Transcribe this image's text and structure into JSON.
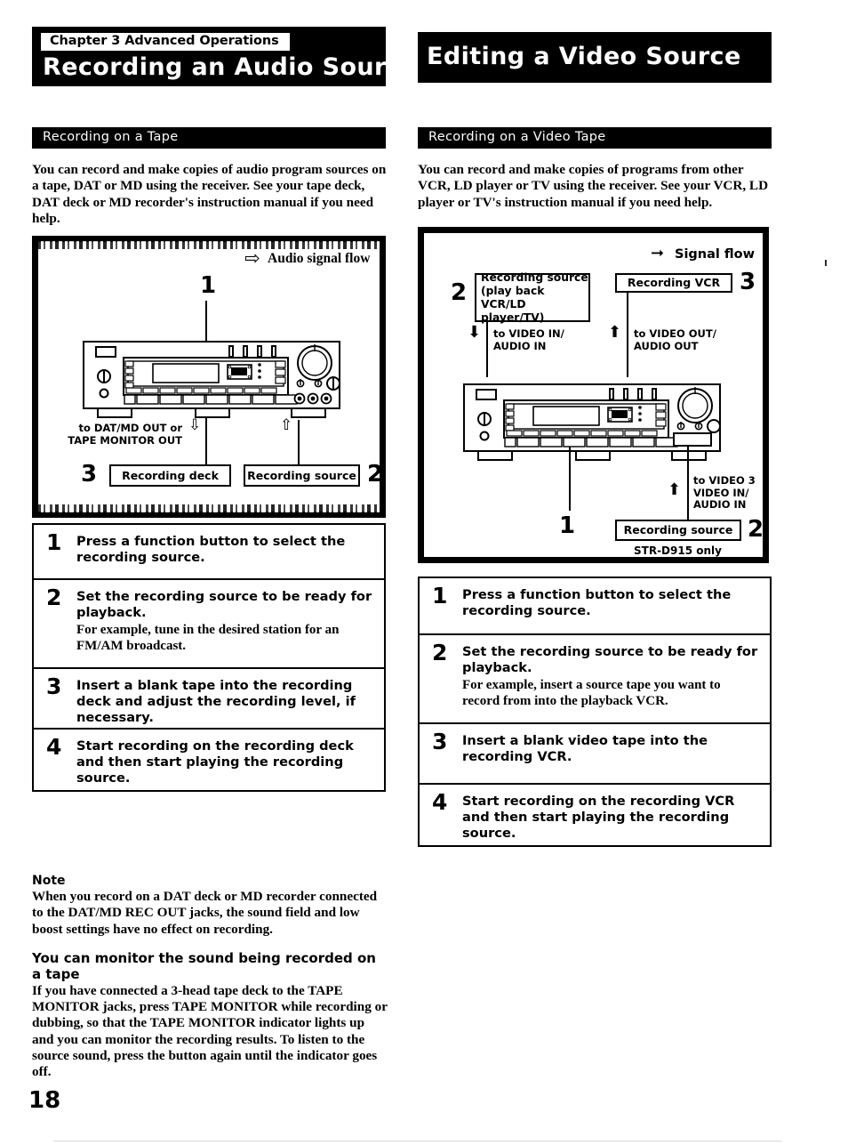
{
  "page": {
    "number": "18"
  },
  "left": {
    "chapter_tag": "Chapter 3 Advanced Operations",
    "title": "Recording an Audio Source",
    "section_bar": "Recording on a Tape",
    "intro": "You can record and make copies of audio program sources on a tape, DAT or MD using the receiver.  See your tape deck, DAT deck or MD recorder's instruction manual if you need help.",
    "diagram": {
      "flow_legend": "Audio signal flow",
      "flow_arrow_icon": "thick-right-arrow-icon",
      "callout_1": "1",
      "callout_2": "2",
      "callout_3": "3",
      "out_label": "to DAT/MD OUT or\nTAPE MONITOR OUT",
      "box_recording_deck": "Recording deck",
      "box_recording_source": "Recording source",
      "arrow_down_icon": "outline-down-arrow-icon",
      "arrow_up_icon": "outline-up-arrow-icon"
    },
    "steps": [
      {
        "num": "1",
        "head": "Press a function button to select the recording source.",
        "sub": ""
      },
      {
        "num": "2",
        "head": "Set the recording source to be ready for playback.",
        "sub": "For example, tune in the desired station for an FM/AM broadcast."
      },
      {
        "num": "3",
        "head": "Insert a blank tape into the recording deck and adjust the recording level, if necessary.",
        "sub": ""
      },
      {
        "num": "4",
        "head": "Start recording on the recording deck and then start playing the recording source.",
        "sub": ""
      }
    ],
    "notes": [
      {
        "head": "Note",
        "body": "When you record on a DAT deck or MD recorder connected to the DAT/MD REC OUT jacks, the sound field and low boost settings have no effect on recording."
      },
      {
        "head": "You can monitor the sound being recorded on a tape",
        "body": "If you have connected a 3-head tape deck to the TAPE MONITOR jacks, press TAPE MONITOR while recording or dubbing, so that the TAPE MONITOR indicator lights up and you can monitor the recording results. To listen to the source sound, press the button again until the indicator goes off."
      }
    ]
  },
  "right": {
    "title": "Editing a Video Source",
    "section_bar": "Recording on a Video Tape",
    "intro": "You can record and make copies of programs from other VCR, LD player or TV using the receiver.  See your VCR, LD player or TV's instruction manual if you need help.",
    "diagram": {
      "flow_legend": "Signal flow",
      "flow_arrow_icon": "solid-right-arrow-icon",
      "callout_1": "1",
      "callout_2_top": "2",
      "callout_3": "3",
      "callout_2_bottom": "2",
      "box_recording_source_play": "Recording source\n(play back VCR/LD\nplayer/TV)",
      "box_recording_vcr": "Recording VCR",
      "box_recording_source": "Recording source",
      "label_video_in": "to VIDEO IN/\nAUDIO IN",
      "label_video_out": "to VIDEO OUT/\nAUDIO OUT",
      "label_video3_in": "to VIDEO 3\nVIDEO IN/\nAUDIO IN",
      "model_note": "STR-D915 only",
      "arrow_down_icon": "solid-down-arrow-icon",
      "arrow_up_icon": "solid-up-arrow-icon"
    },
    "steps": [
      {
        "num": "1",
        "head": "Press a function button to select the recording source.",
        "sub": ""
      },
      {
        "num": "2",
        "head": "Set the recording source to be ready for playback.",
        "sub": "For example, insert a source tape you want to record from into the playback VCR."
      },
      {
        "num": "3",
        "head": "Insert a blank video tape into the recording VCR.",
        "sub": ""
      },
      {
        "num": "4",
        "head": "Start recording on the recording VCR and then start playing the recording source.",
        "sub": ""
      }
    ]
  }
}
